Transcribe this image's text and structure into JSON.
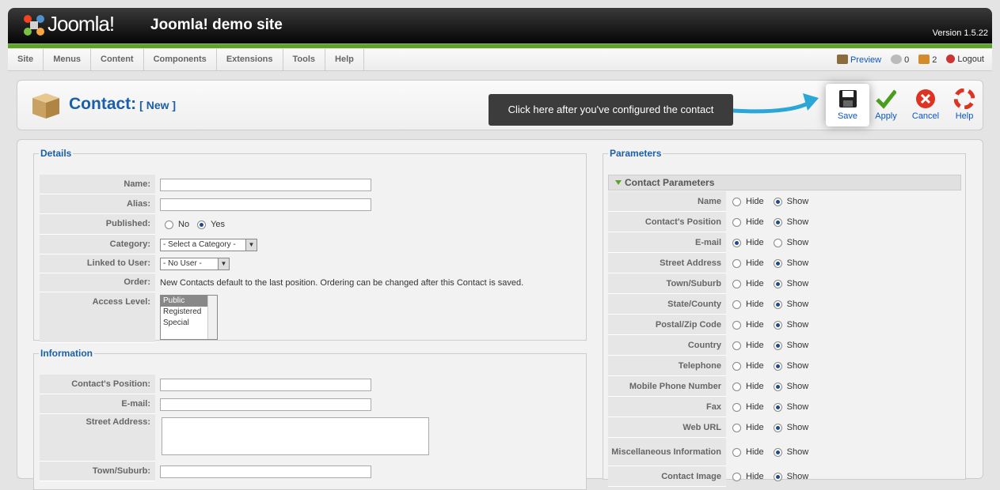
{
  "header": {
    "logo_text": "Joomla!",
    "site_name": "Joomla! demo site",
    "version": "Version 1.5.22"
  },
  "menu": [
    "Site",
    "Menus",
    "Content",
    "Components",
    "Extensions",
    "Tools",
    "Help"
  ],
  "status": {
    "preview": "Preview",
    "messages": "0",
    "users": "2",
    "logout": "Logout"
  },
  "toolbar": {
    "title": "Contact:",
    "subtitle": "[ New ]",
    "tooltip": "Click here after you've configured the contact",
    "buttons": {
      "save": "Save",
      "apply": "Apply",
      "cancel": "Cancel",
      "help": "Help"
    }
  },
  "details": {
    "legend": "Details",
    "name_label": "Name:",
    "alias_label": "Alias:",
    "published_label": "Published:",
    "published_no": "No",
    "published_yes": "Yes",
    "category_label": "Category:",
    "category_value": "- Select a Category -",
    "linked_label": "Linked to User:",
    "linked_value": "- No User -",
    "order_label": "Order:",
    "order_text": "New Contacts default to the last position. Ordering can be changed after this Contact is saved.",
    "access_label": "Access Level:",
    "access_options": [
      "Public",
      "Registered",
      "Special"
    ]
  },
  "information": {
    "legend": "Information",
    "position_label": "Contact's Position:",
    "email_label": "E-mail:",
    "street_label": "Street Address:",
    "town_label": "Town/Suburb:"
  },
  "parameters": {
    "legend": "Parameters",
    "panel_title": "Contact Parameters",
    "hide": "Hide",
    "show": "Show",
    "rows": [
      {
        "label": "Name",
        "value": "Show"
      },
      {
        "label": "Contact's Position",
        "value": "Show"
      },
      {
        "label": "E-mail",
        "value": "Hide"
      },
      {
        "label": "Street Address",
        "value": "Show"
      },
      {
        "label": "Town/Suburb",
        "value": "Show"
      },
      {
        "label": "State/County",
        "value": "Show"
      },
      {
        "label": "Postal/Zip Code",
        "value": "Show"
      },
      {
        "label": "Country",
        "value": "Show"
      },
      {
        "label": "Telephone",
        "value": "Show"
      },
      {
        "label": "Mobile Phone Number",
        "value": "Show"
      },
      {
        "label": "Fax",
        "value": "Show"
      },
      {
        "label": "Web URL",
        "value": "Show"
      },
      {
        "label": "Miscellaneous Information",
        "value": "Show"
      },
      {
        "label": "Contact Image",
        "value": "Show"
      }
    ]
  }
}
